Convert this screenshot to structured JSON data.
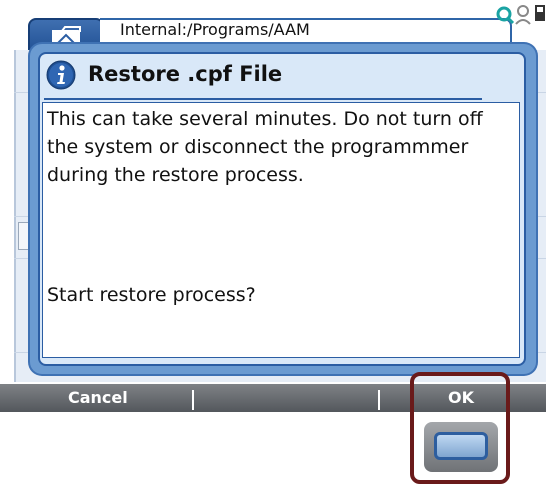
{
  "header": {
    "path": "Internal:/Programs/AAM",
    "icons": [
      "folder-icon",
      "search-icon",
      "user-icon",
      "battery-icon"
    ]
  },
  "dialog": {
    "icon": "info-icon",
    "title": "Restore .cpf File",
    "message": "This can take several minutes. Do not turn off the system or disconnect the programmmer during the restore process.",
    "question": "Start restore process?"
  },
  "softkeys": {
    "left_label": "Cancel",
    "right_label": "OK"
  },
  "colors": {
    "dialog_frame": "#6b9bd1",
    "dialog_border": "#2b5da3",
    "highlight": "#6a1a1a",
    "softkey_bar": "#5f6368"
  }
}
